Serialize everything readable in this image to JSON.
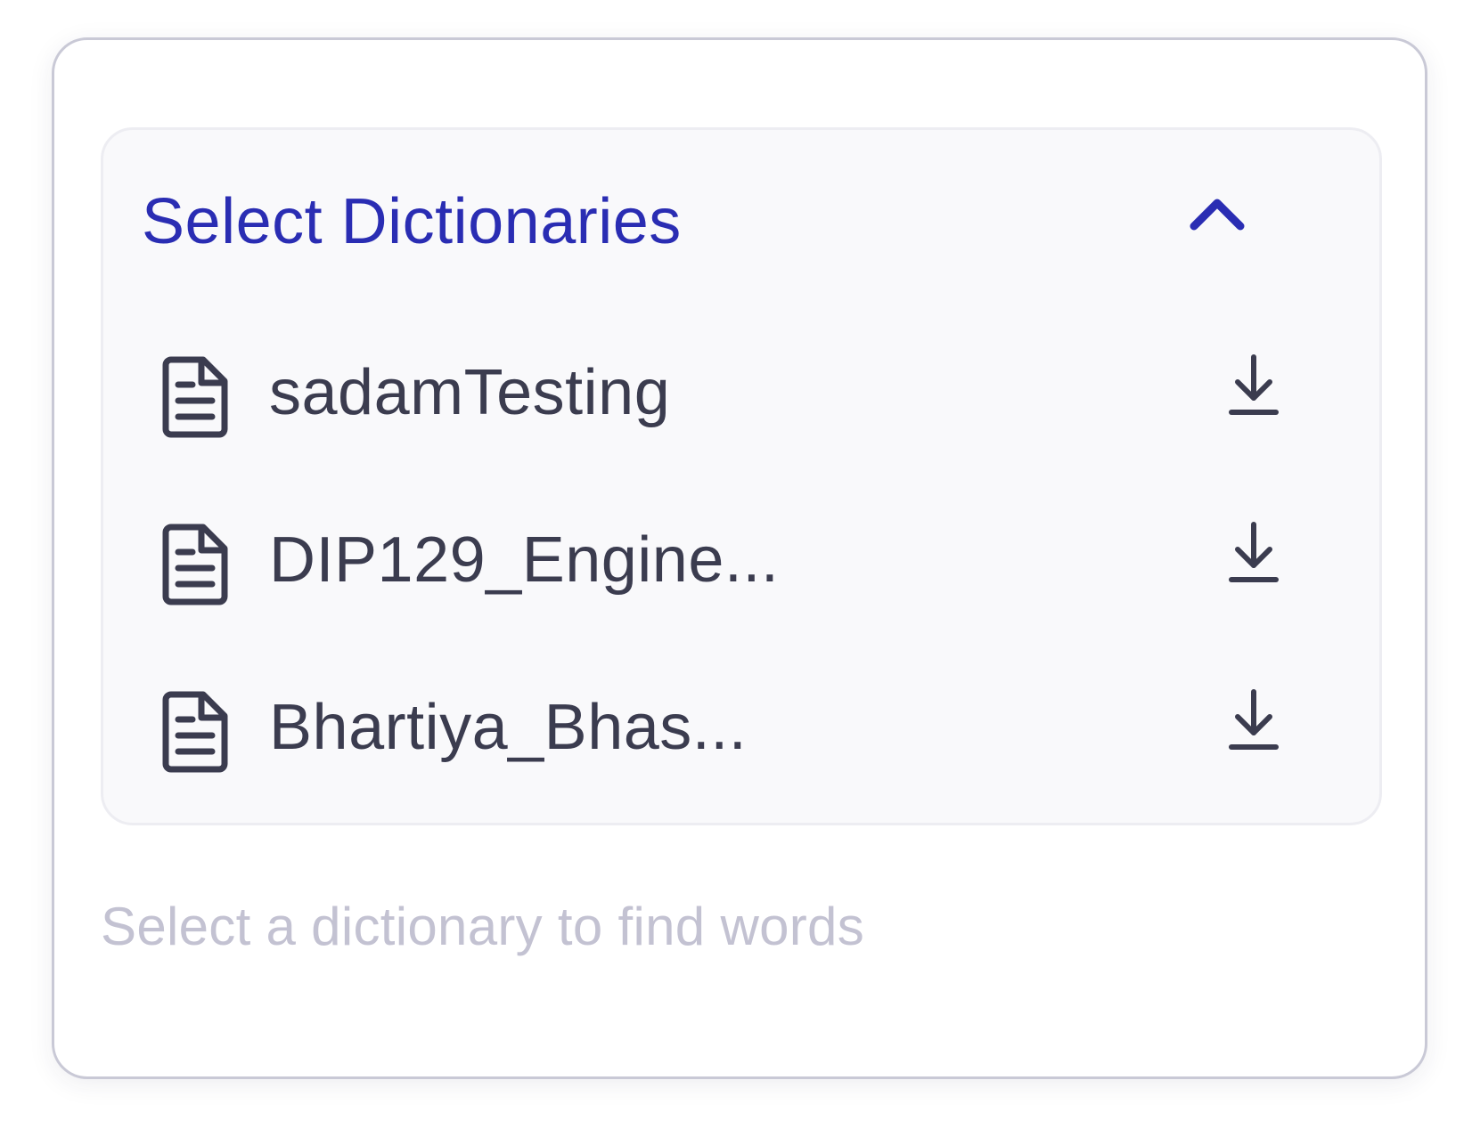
{
  "dictionary_selector": {
    "title": "Select Dictionaries",
    "expanded": true,
    "items": [
      {
        "label": "sadamTesting",
        "icon": "file-text-icon",
        "action_icon": "download-icon"
      },
      {
        "label": "DIP129_Engine...",
        "icon": "file-text-icon",
        "action_icon": "download-icon"
      },
      {
        "label": "Bhartiya_Bhas...",
        "icon": "file-text-icon",
        "action_icon": "download-icon"
      }
    ]
  },
  "hint": "Select a dictionary to find words",
  "colors": {
    "accent": "#2a2db3",
    "item_text": "#3b3c4f",
    "hint_text": "#c3c2d2",
    "panel_bg": "#f9f9fb",
    "card_border": "#c9c9d6"
  }
}
